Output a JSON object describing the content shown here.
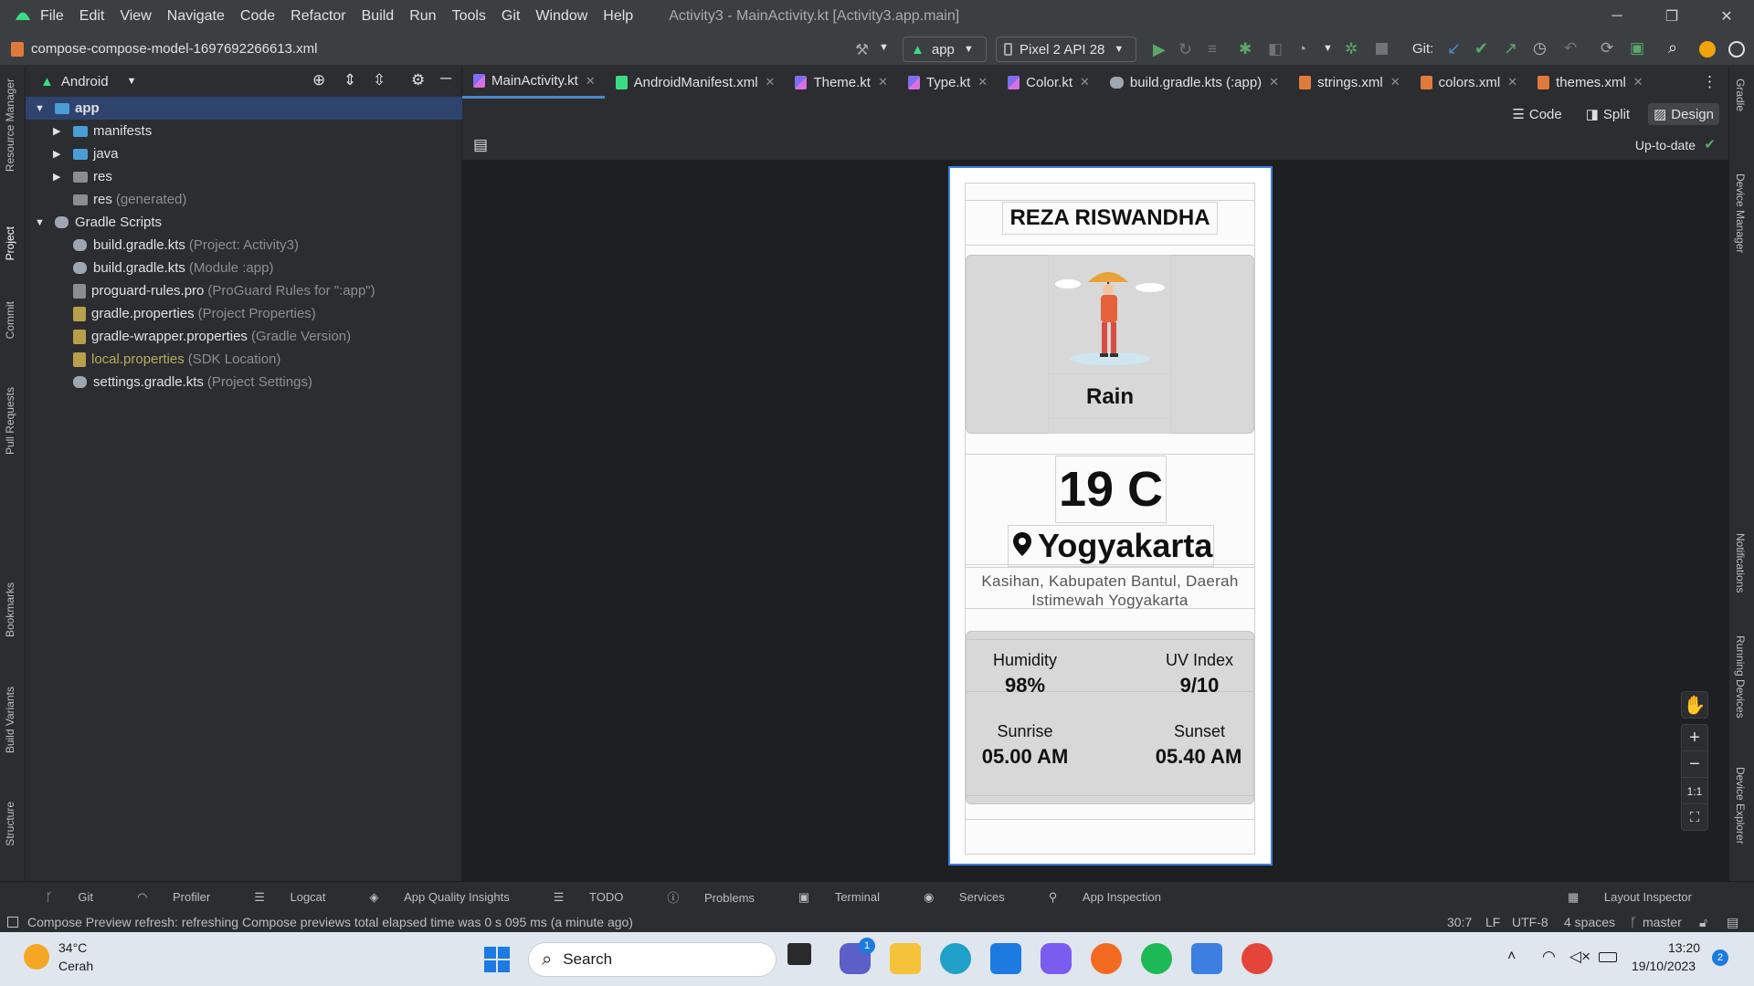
{
  "window": {
    "menu": [
      "File",
      "Edit",
      "View",
      "Navigate",
      "Code",
      "Refactor",
      "Build",
      "Run",
      "Tools",
      "Git",
      "Window",
      "Help"
    ],
    "title": "Activity3 - MainActivity.kt [Activity3.app.main]",
    "controls": {
      "minimize": "─",
      "restore": "❐",
      "close": "✕"
    }
  },
  "navbar": {
    "breadcrumb": "compose-compose-model-1697692266613.xml",
    "run_config": "app",
    "device": "Pixel 2 API 28",
    "git_label": "Git:"
  },
  "left_strip": {
    "tabs": [
      "Resource Manager",
      "Project",
      "Commit",
      "Pull Requests",
      "Bookmarks",
      "Build Variants",
      "Structure"
    ]
  },
  "right_strip": {
    "tabs": [
      "Gradle",
      "Device Manager",
      "Notifications",
      "Running Devices",
      "Device Explorer"
    ]
  },
  "project": {
    "view_label": "Android",
    "tree": [
      {
        "label": "app",
        "hint": "",
        "kind": "module"
      },
      {
        "label": "manifests",
        "hint": "",
        "kind": "folder"
      },
      {
        "label": "java",
        "hint": "",
        "kind": "folder"
      },
      {
        "label": "res",
        "hint": "",
        "kind": "folder"
      },
      {
        "label": "res",
        "hint": "(generated)",
        "kind": "folder"
      },
      {
        "label": "Gradle Scripts",
        "hint": "",
        "kind": "group"
      },
      {
        "label": "build.gradle.kts",
        "hint": "(Project: Activity3)",
        "kind": "file"
      },
      {
        "label": "build.gradle.kts",
        "hint": "(Module :app)",
        "kind": "file"
      },
      {
        "label": "proguard-rules.pro",
        "hint": "(ProGuard Rules for \":app\")",
        "kind": "file"
      },
      {
        "label": "gradle.properties",
        "hint": "(Project Properties)",
        "kind": "file"
      },
      {
        "label": "gradle-wrapper.properties",
        "hint": "(Gradle Version)",
        "kind": "file"
      },
      {
        "label": "local.properties",
        "hint": "(SDK Location)",
        "kind": "file"
      },
      {
        "label": "settings.gradle.kts",
        "hint": "(Project Settings)",
        "kind": "file"
      }
    ]
  },
  "editor": {
    "tabs": [
      "MainActivity.kt",
      "AndroidManifest.xml",
      "Theme.kt",
      "Type.kt",
      "Color.kt",
      "build.gradle.kts (:app)",
      "strings.xml",
      "colors.xml",
      "themes.xml"
    ],
    "active_tab": "MainActivity.kt",
    "modes": [
      "Code",
      "Split",
      "Design"
    ],
    "active_mode": "Design",
    "status": "Up-to-date",
    "zoom_labels": [
      "+",
      "−",
      "1:1"
    ]
  },
  "preview": {
    "name": "REZA RISWANDHA",
    "weather": "Rain",
    "temperature": "19 C",
    "city": "Yogyakarta",
    "address": "Kasihan, Kabupaten Bantul, Daerah Istimewah Yogyakarta",
    "humidity_label": "Humidity",
    "humidity_value": "98%",
    "uv_label": "UV Index",
    "uv_value": "9/10",
    "sunrise_label": "Sunrise",
    "sunrise_value": "05.00 AM",
    "sunset_label": "Sunset",
    "sunset_value": "05.40 AM"
  },
  "bottom_tools": [
    "Git",
    "Profiler",
    "Logcat",
    "App Quality Insights",
    "TODO",
    "Problems",
    "Terminal",
    "Services",
    "App Inspection"
  ],
  "layout_inspector": "Layout Inspector",
  "statusbar": {
    "message": "Compose Preview refresh: refreshing Compose previews total elapsed time was 0 s 095 ms (a minute ago)",
    "position": "30:7",
    "line_sep": "LF",
    "encoding": "UTF-8",
    "indent": "4 spaces",
    "branch": "master"
  },
  "taskbar": {
    "weather_temp": "34°C",
    "weather_desc": "Cerah",
    "search": "Search",
    "teams_badge": "1",
    "time": "13:20",
    "date": "19/10/2023",
    "notif_count": "2"
  }
}
